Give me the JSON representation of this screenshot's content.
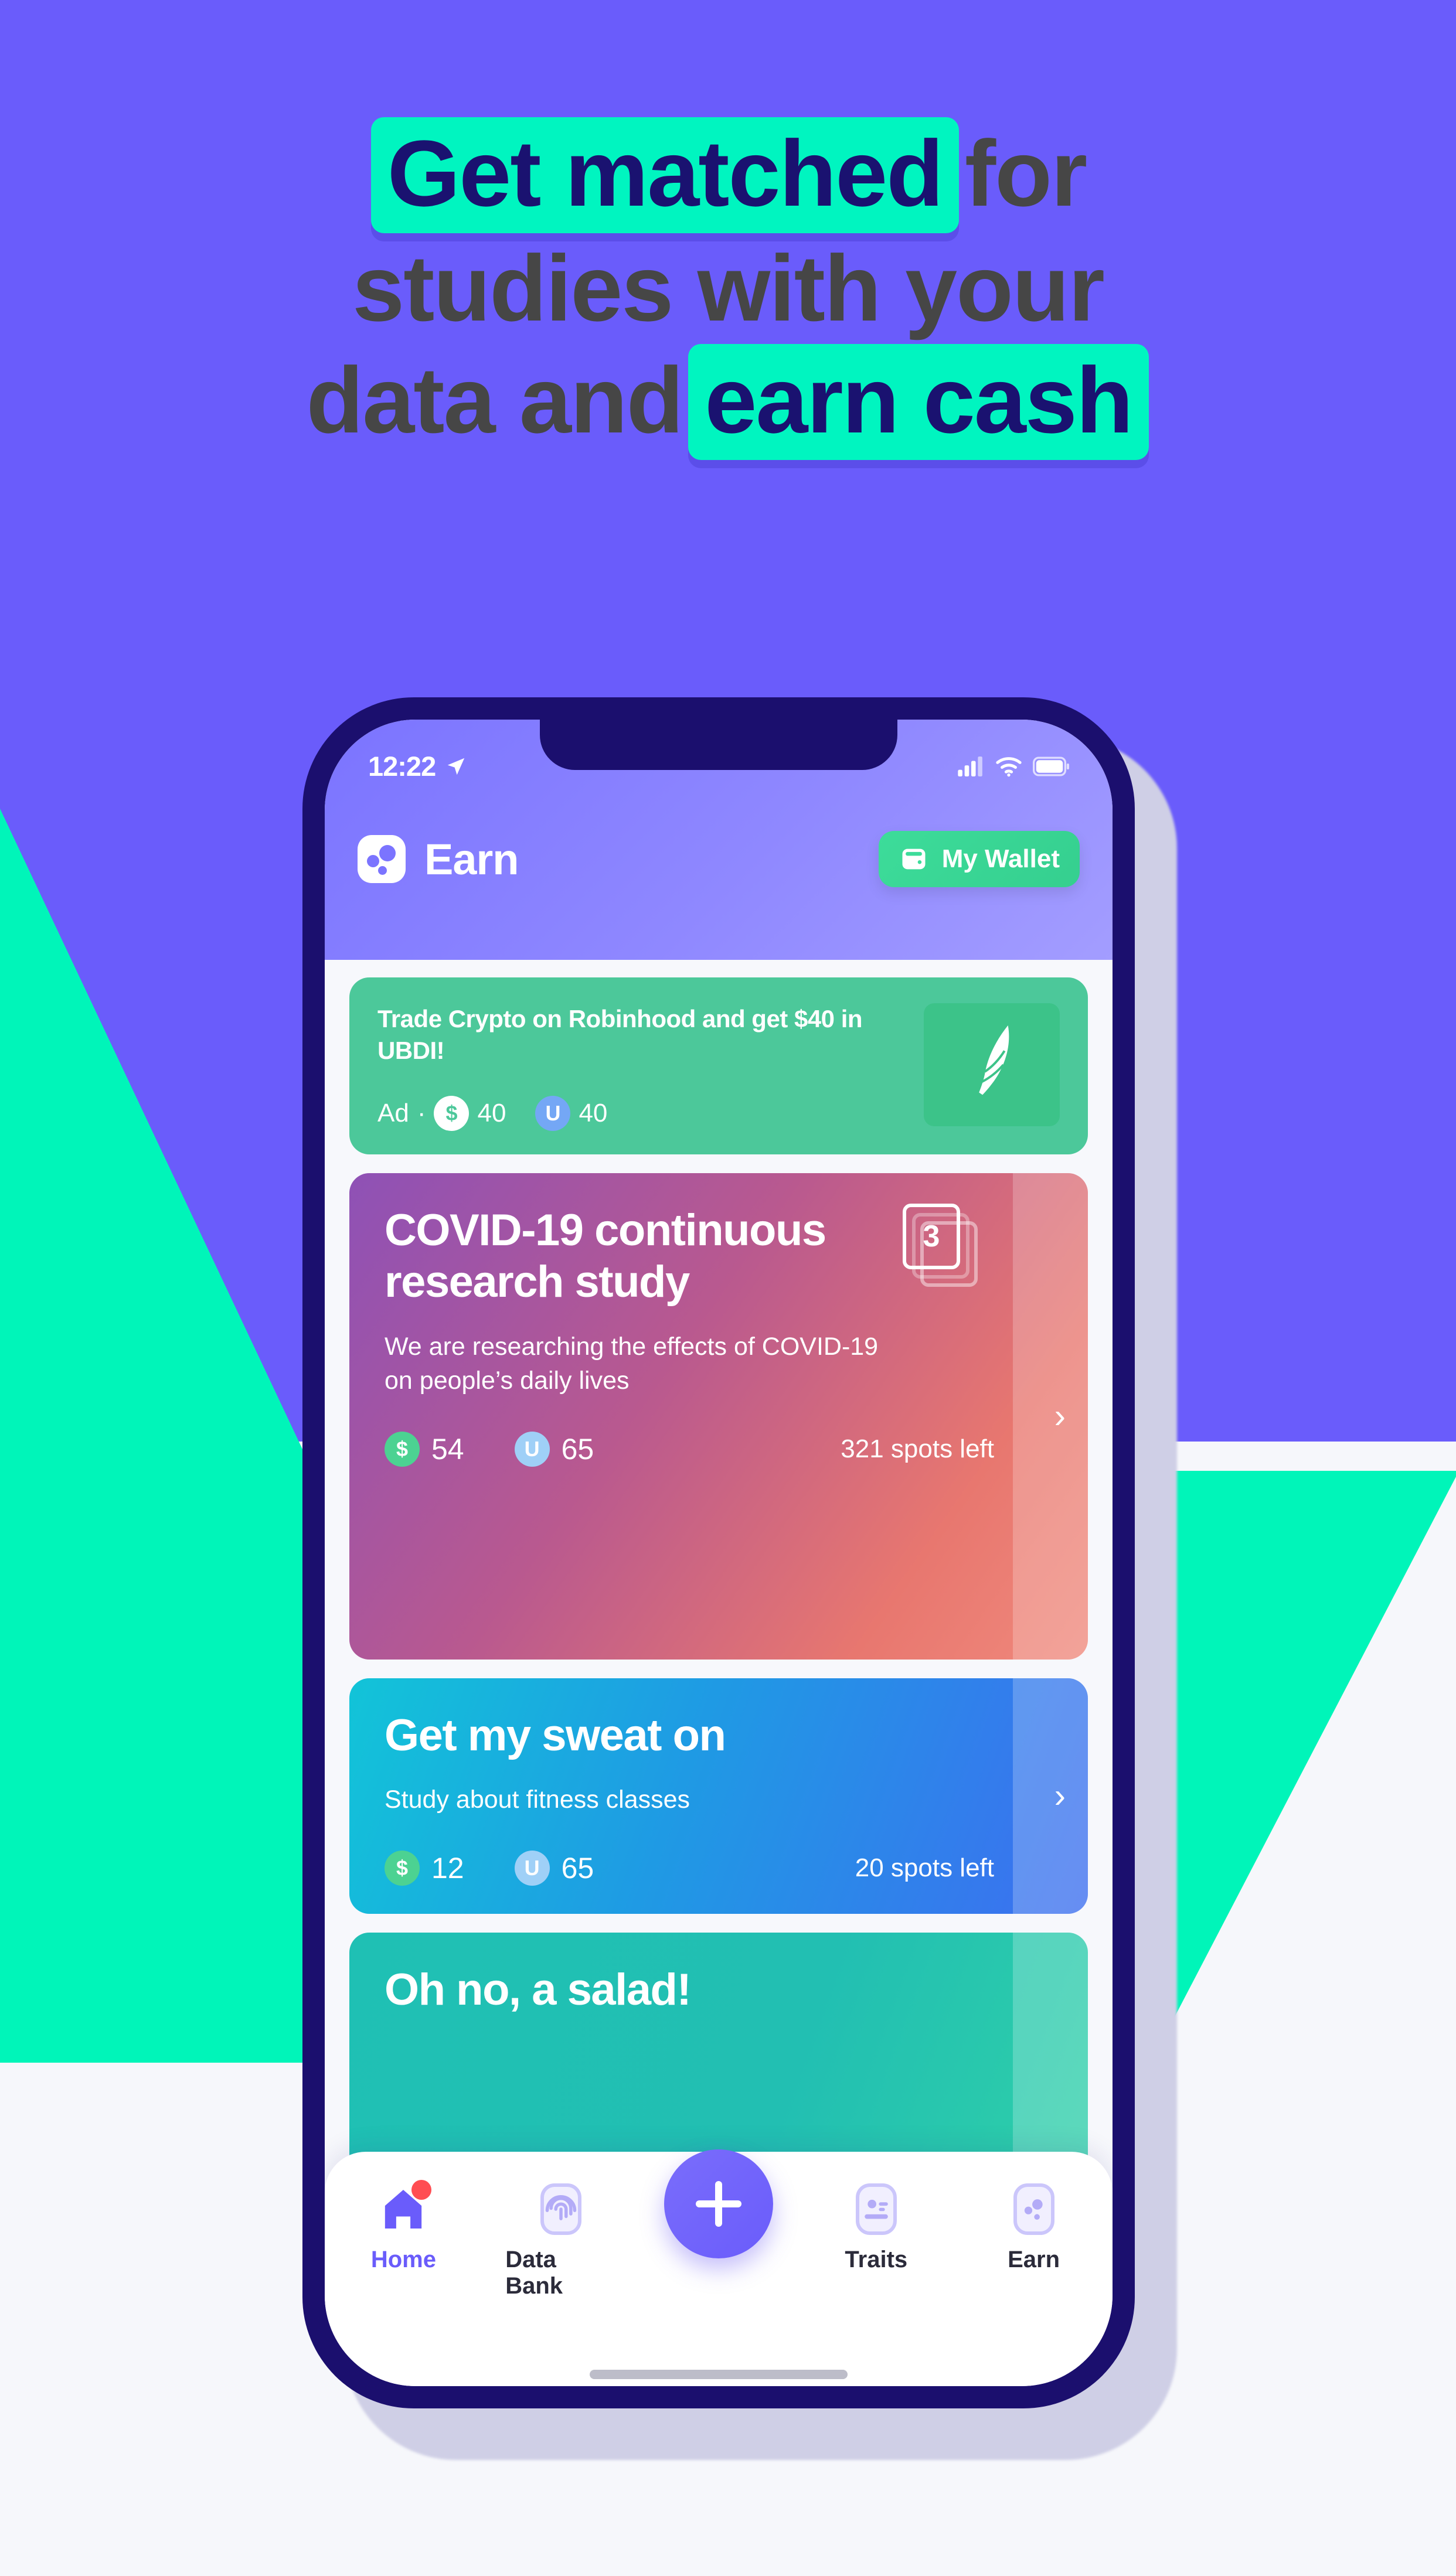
{
  "hero": {
    "line1_highlight": "Get matched",
    "line1_plain": "for",
    "line2": "studies with your",
    "line3_plain": "data and",
    "line3_highlight": "earn cash",
    "highlight_bg": "#00f5c0",
    "highlight_text_color": "#1a1270",
    "plain_text_color": "#464646",
    "page_bg": "#6a5cfb",
    "accent_mint": "#00f5b9"
  },
  "phone": {
    "statusbar": {
      "time": "12:22",
      "location_icon": "location-arrow-icon",
      "cellular_icon": "cellular-bars-icon",
      "wifi_icon": "wifi-icon",
      "battery_icon": "battery-full-icon"
    },
    "header": {
      "logo_icon": "earn-app-logo-icon",
      "title": "Earn",
      "wallet_button": {
        "label": "My Wallet",
        "icon": "wallet-icon",
        "color": "#3ddc9a"
      }
    },
    "ad_card": {
      "headline": "Trade Crypto on Robinhood and get $40 in UBDI!",
      "ad_label": "Ad",
      "separator": "·",
      "cash_icon": "dollar-coin-icon",
      "cash_value": "40",
      "ubdi_icon": "ubdi-token-icon",
      "ubdi_value": "40",
      "brand_icon": "robinhood-feather-icon",
      "bg_color": "#4cc89a"
    },
    "study_cards": [
      {
        "title": "COVID-19 continuous research study",
        "subtitle": "We are researching the effects of COVID-19 on people’s daily lives",
        "cash_value": "54",
        "ubdi_value": "65",
        "spots": "321 spots left",
        "stack_count": "3",
        "stack_icon": "card-stack-icon",
        "chevron_icon": "chevron-right-icon",
        "gradient": "purple-to-coral"
      },
      {
        "title": "Get my sweat on",
        "subtitle": "Study about fitness classes",
        "cash_value": "12",
        "ubdi_value": "65",
        "spots": "20 spots left",
        "chevron_icon": "chevron-right-icon",
        "gradient": "cyan-to-blue"
      },
      {
        "title": "Oh no, a salad!",
        "subtitle": "",
        "gradient": "teal-to-green"
      }
    ],
    "tabbar": {
      "items": [
        {
          "label": "Home",
          "icon": "home-icon",
          "active": true,
          "badge": true
        },
        {
          "label": "Data Bank",
          "icon": "fingerprint-icon",
          "active": false,
          "badge": false
        },
        {
          "label": "Traits",
          "icon": "id-card-icon",
          "active": false,
          "badge": false
        },
        {
          "label": "Earn",
          "icon": "earn-bubbles-icon",
          "active": false,
          "badge": false
        }
      ],
      "fab": {
        "icon": "plus-icon",
        "color": "#6a5cfb"
      }
    }
  }
}
